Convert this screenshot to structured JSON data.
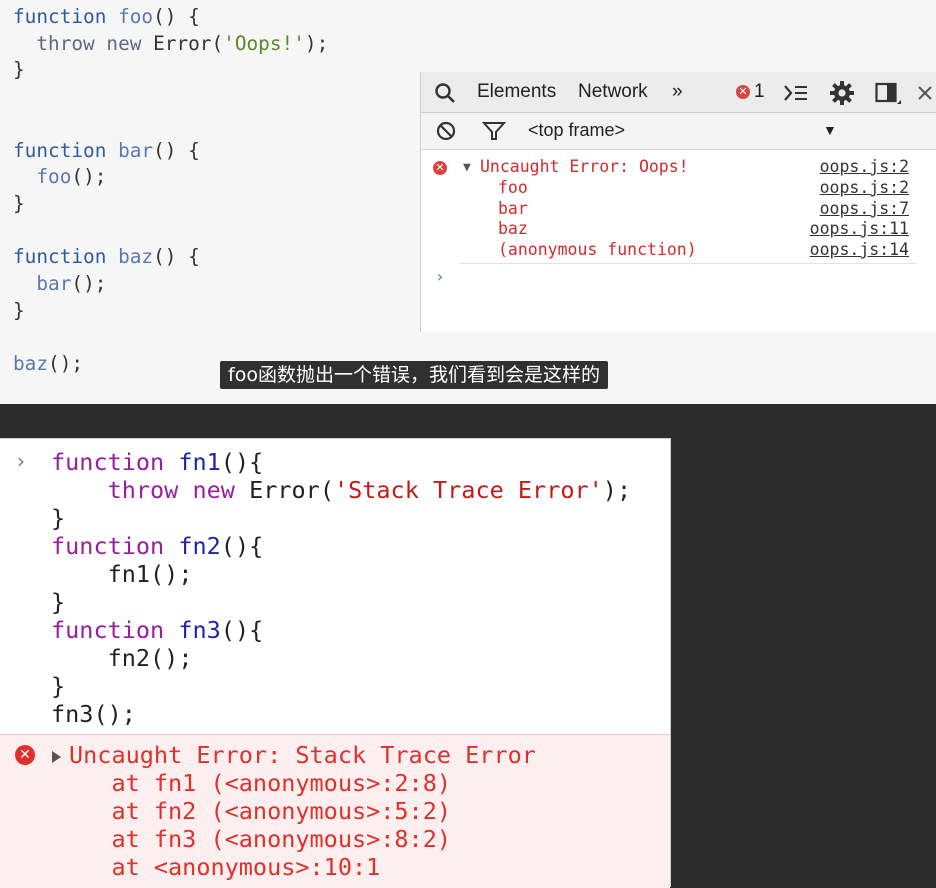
{
  "top_code": {
    "lines": [
      [
        [
          "kw",
          "function "
        ],
        [
          "fnm",
          "foo"
        ],
        [
          "",
          "() {"
        ]
      ],
      [
        [
          "",
          "  "
        ],
        [
          "kw2",
          "throw "
        ],
        [
          "kw2",
          "new "
        ],
        [
          "",
          "Error("
        ],
        [
          "str",
          "'Oops!'"
        ],
        [
          "",
          ");"
        ]
      ],
      [
        [
          "",
          "}"
        ]
      ],
      [
        [
          "",
          ""
        ]
      ],
      [
        [
          "",
          ""
        ]
      ],
      [
        [
          "kw",
          "function "
        ],
        [
          "fnm",
          "bar"
        ],
        [
          "",
          "() {"
        ]
      ],
      [
        [
          "",
          "  "
        ],
        [
          "fnm",
          "foo"
        ],
        [
          "",
          "();"
        ]
      ],
      [
        [
          "",
          "}"
        ]
      ],
      [
        [
          "",
          ""
        ]
      ],
      [
        [
          "kw",
          "function "
        ],
        [
          "fnm",
          "baz"
        ],
        [
          "",
          "() {"
        ]
      ],
      [
        [
          "",
          "  "
        ],
        [
          "fnm",
          "bar"
        ],
        [
          "",
          "();"
        ]
      ],
      [
        [
          "",
          "}"
        ]
      ],
      [
        [
          "",
          ""
        ]
      ],
      [
        [
          "fnm",
          "baz"
        ],
        [
          "",
          "();"
        ]
      ]
    ]
  },
  "devtools": {
    "tabs": {
      "elements": "Elements",
      "network": "Network",
      "more": "»"
    },
    "error_count": "1",
    "filter": {
      "frame": "<top frame>"
    },
    "console": {
      "error_message": "Uncaught Error: Oops!",
      "error_source": "oops.js:2",
      "frames": [
        {
          "name": "foo",
          "source": "oops.js:2"
        },
        {
          "name": "bar",
          "source": "oops.js:7"
        },
        {
          "name": "baz",
          "source": "oops.js:11"
        },
        {
          "name": "(anonymous function)",
          "source": "oops.js:14"
        }
      ]
    }
  },
  "subtitle": "foo函数抛出一个错误，我们看到会是这样的",
  "bottom_console": {
    "lines": [
      [
        [
          "k2",
          "function "
        ],
        [
          "f2",
          "fn1"
        ],
        [
          "",
          "(){"
        ]
      ],
      [
        [
          "",
          "    "
        ],
        [
          "k2",
          "throw "
        ],
        [
          "k2",
          "new "
        ],
        [
          "",
          "Error("
        ],
        [
          "s2",
          "'Stack Trace Error'"
        ],
        [
          "",
          ");"
        ]
      ],
      [
        [
          "",
          "}"
        ]
      ],
      [
        [
          "k2",
          "function "
        ],
        [
          "f2",
          "fn2"
        ],
        [
          "",
          "(){"
        ]
      ],
      [
        [
          "",
          "    fn1();"
        ]
      ],
      [
        [
          "",
          "}"
        ]
      ],
      [
        [
          "k2",
          "function "
        ],
        [
          "f2",
          "fn3"
        ],
        [
          "",
          "(){"
        ]
      ],
      [
        [
          "",
          "    fn2();"
        ]
      ],
      [
        [
          "",
          "}"
        ]
      ],
      [
        [
          "",
          "fn3();"
        ]
      ]
    ],
    "error_lines": [
      "Uncaught Error: Stack Trace Error",
      "   at fn1 (<anonymous>:2:8)",
      "   at fn2 (<anonymous>:5:2)",
      "   at fn3 (<anonymous>:8:2)",
      "   at <anonymous>:10:1"
    ]
  },
  "colors": {
    "error_red": "#e0302a",
    "keyword_purple": "#9a1e9e",
    "function_blue": "#1c24a8",
    "subtitle_bg": "#141414"
  }
}
